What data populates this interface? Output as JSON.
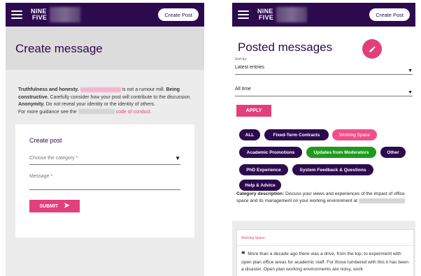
{
  "colors": {
    "brand": "#2d0a4e",
    "accent": "#e2407a",
    "green": "#1f9a1f"
  },
  "header": {
    "logo_line1": "NINE",
    "logo_line2": "FIVE",
    "create_post": "Create Post"
  },
  "create_page": {
    "title": "Create message",
    "guidance": {
      "p1_bold": "Truthfulness and honesty.",
      "p1_rest": "is not a rumour mill.",
      "p2_bold": "Being constructive.",
      "p2_rest": "Carefully consider how your post will contribute to the discussion.",
      "p3_bold": "Anonymity.",
      "p3_rest": "Do not reveal your identity or the identity of others.",
      "p4": "For more guidance see the",
      "link": "code of conduct."
    },
    "form": {
      "title": "Create post",
      "category_placeholder": "Choose the category *",
      "message_label": "Message *",
      "submit": "SUBMIT"
    }
  },
  "posted_page": {
    "title": "Posted messages",
    "sort_by_label": "Sort by:",
    "sort_value": "Latest entries",
    "time_value": "All time",
    "apply": "APPLY",
    "chips": [
      "ALL",
      "Fixed-Term Contracts",
      "Working Space",
      "Academic Promotions",
      "Updates from Moderators",
      "Other",
      "PhD Experience",
      "System Feedback & Questions",
      "Help & Advice"
    ],
    "category_description_label": "Category description:",
    "category_description_text": "Discuss your views and experiences of the impact of office space and its management on your working environment at",
    "post": {
      "tag": "Working Space",
      "quote_glyph": "❝",
      "body": "More than a decade ago there was a drive, from the top, to experiment with open plan office areas for academic staff.  For those lumbered with this it has been a disaster. Open plan working environments are noisy, work"
    }
  }
}
